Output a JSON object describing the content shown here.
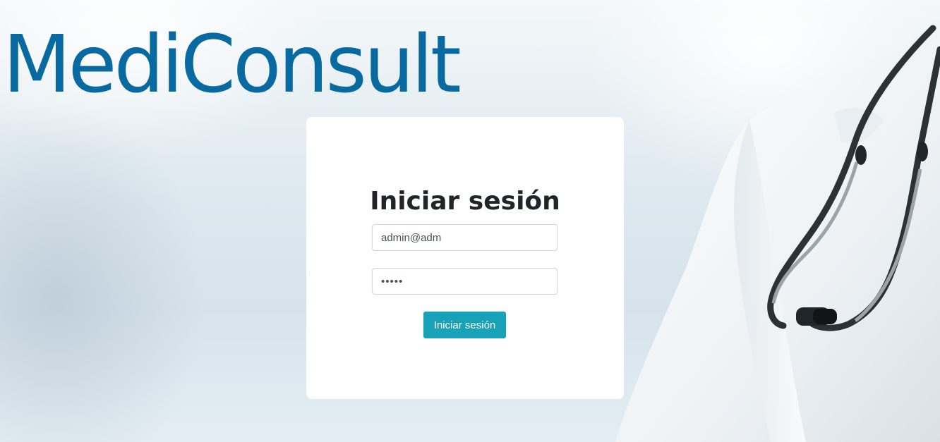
{
  "header": {
    "brand": "MediConsult"
  },
  "login": {
    "title": "Iniciar sesión",
    "email_value": "admin@adm",
    "password_value": "•••••",
    "submit_label": "Iniciar sesión"
  },
  "colors": {
    "brand": "#086aa0",
    "button": "#17a2b8",
    "card": "#ffffff"
  },
  "icons": {
    "background": "doctor-stethoscope-image"
  }
}
